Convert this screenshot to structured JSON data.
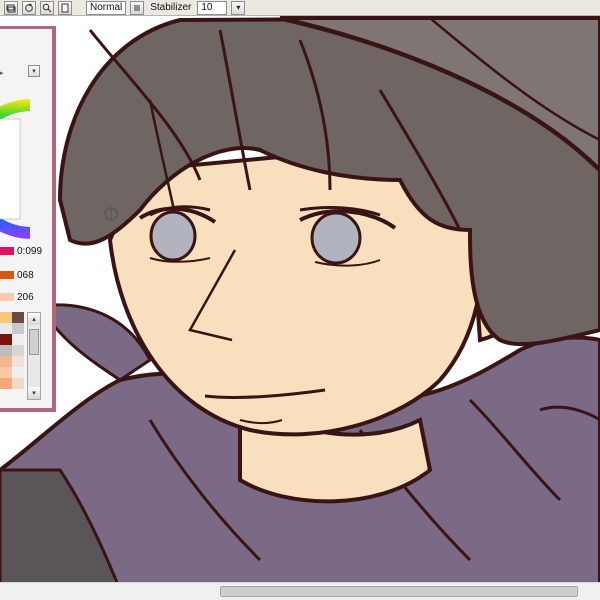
{
  "toolbar": {
    "blend_mode": "Normal",
    "stabilizer_label": "Stabilizer",
    "stabilizer_value": "10",
    "dropdown_glyph": "▾"
  },
  "color_panel": {
    "sliders": [
      {
        "value": "0:099",
        "color": "#e0115f"
      },
      {
        "value": "068",
        "color": "#d9580d"
      },
      {
        "value": "206",
        "color": "#f6c9b0"
      }
    ],
    "swatches": [
      "#f6c97a",
      "#6b4a3f",
      "#e9e9e9",
      "#c9c9c9",
      "#7b1210",
      "#efefef",
      "#bdbdbd",
      "#d7d7d7",
      "#f5b58f",
      "#f4e1d3",
      "#f9c9a6",
      "#efefef",
      "#f7a67a",
      "#f1d9c8"
    ]
  },
  "colors": {
    "panel_frame": "#b2677b",
    "skin": "#f8dfbe",
    "hair": "#6f6562",
    "hoodie": "#7a6a85",
    "lineart": "#3a1414",
    "eye": "#b1b3bf"
  }
}
